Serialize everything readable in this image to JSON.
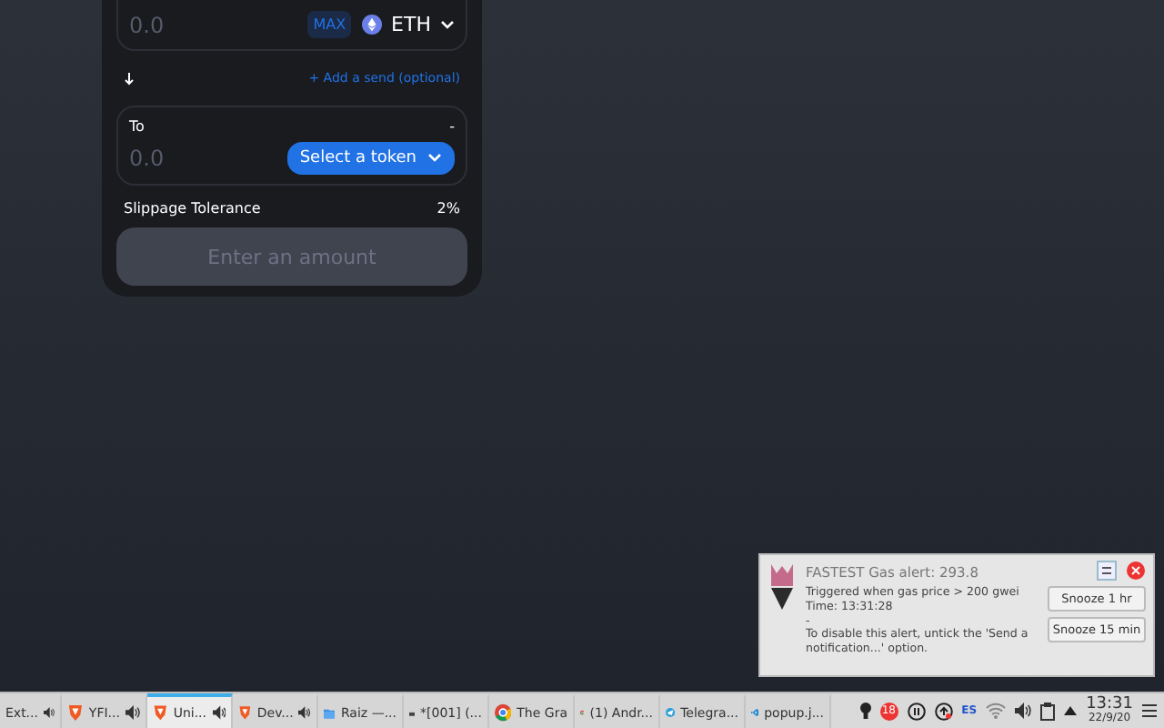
{
  "swap": {
    "from": {
      "amount_placeholder": "0.0",
      "max_label": "MAX",
      "token": "ETH"
    },
    "add_send": "+ Add a send (optional)",
    "to": {
      "label": "To",
      "balance": "-",
      "amount_placeholder": "0.0",
      "select_label": "Select a token"
    },
    "slippage": {
      "label": "Slippage Tolerance",
      "value": "2%"
    },
    "submit": {
      "label": "Enter an amount",
      "disabled": true
    }
  },
  "notification": {
    "title": "FASTEST Gas alert: 293.8",
    "lines": [
      "Triggered when gas price > 200 gwei",
      "Time: 13:31:28",
      "-",
      "To disable this alert, untick the 'Send a notification...' option."
    ],
    "buttons": [
      "Snooze 1 hr",
      "Snooze 15 min"
    ]
  },
  "taskbar": {
    "items": [
      {
        "label": "Ext...",
        "kind": "none",
        "audio": true,
        "selected": false
      },
      {
        "label": "YFI...",
        "kind": "brave",
        "audio": true,
        "selected": false
      },
      {
        "label": "Uni...",
        "kind": "brave",
        "audio": true,
        "selected": true
      },
      {
        "label": "Dev...",
        "kind": "brave",
        "audio": true,
        "selected": false
      },
      {
        "label": "Raiz —...",
        "kind": "folder",
        "audio": false,
        "selected": false
      },
      {
        "label": "*[001] (...",
        "kind": "editor",
        "audio": false,
        "selected": false
      },
      {
        "label": "The Gra",
        "kind": "chrome",
        "audio": false,
        "selected": false
      },
      {
        "label": "(1) Andr...",
        "kind": "chrome",
        "audio": false,
        "selected": false
      },
      {
        "label": "Telegra...",
        "kind": "telegram",
        "audio": false,
        "selected": false
      },
      {
        "label": "popup.j...",
        "kind": "vscode",
        "audio": false,
        "selected": false
      }
    ],
    "tray": {
      "badge": "18",
      "language": "ES",
      "time": "13:31",
      "date": "22/9/20"
    }
  }
}
